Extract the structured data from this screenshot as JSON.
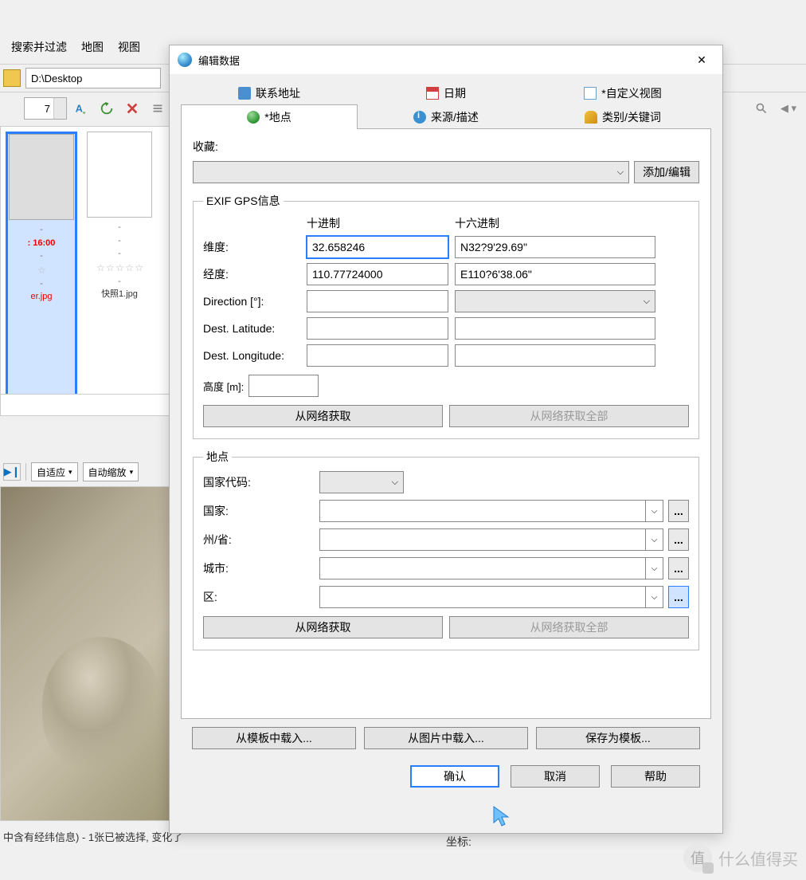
{
  "bg": {
    "menu": {
      "search": "搜索并过滤",
      "map": "地图",
      "view": "视图"
    },
    "path": "D:\\Desktop",
    "spinner": "7",
    "thumbs": [
      {
        "time": ": 16:00",
        "filename": "er.jpg"
      },
      {
        "filename": "快照1.jpg"
      }
    ],
    "zoom": {
      "fit": "自适应",
      "auto": "自动缩放"
    },
    "status": "中含有经纬信息) - 1张已被选择, 变化了",
    "coord_label": "坐标:"
  },
  "dialog": {
    "title": "编辑数据",
    "tabs": {
      "contact": "联系地址",
      "date": "日期",
      "custom": "*自定义视图",
      "location": "*地点",
      "source": "来源/描述",
      "keywords": "类别/关键词"
    },
    "favorites": {
      "label": "收藏:",
      "add_edit": "添加/编辑"
    },
    "gps": {
      "legend": "EXIF GPS信息",
      "decimal": "十进制",
      "hex": "十六进制",
      "latitude_label": "维度:",
      "longitude_label": "经度:",
      "direction_label": "Direction [°]:",
      "dest_lat_label": "Dest. Latitude:",
      "dest_lon_label": "Dest. Longitude:",
      "latitude_dec": "32.658246",
      "latitude_hex": "N32?9'29.69\"",
      "longitude_dec": "110.77724000",
      "longitude_hex": "E110?6'38.06\"",
      "altitude_label": "高度 [m]:",
      "fetch": "从网络获取",
      "fetch_all": "从网络获取全部"
    },
    "place": {
      "legend": "地点",
      "country_code": "国家代码:",
      "country": "国家:",
      "province": "州/省:",
      "city": "城市:",
      "district": "区:",
      "dots": "...",
      "fetch": "从网络获取",
      "fetch_all": "从网络获取全部"
    },
    "footer": {
      "load_template": "从模板中载入...",
      "load_image": "从图片中载入...",
      "save_template": "保存为模板...",
      "ok": "确认",
      "cancel": "取消",
      "help": "帮助"
    }
  },
  "watermark": "什么值得买"
}
